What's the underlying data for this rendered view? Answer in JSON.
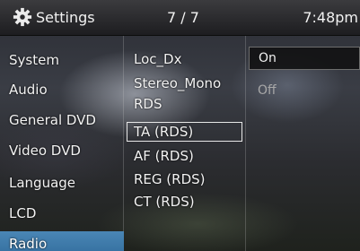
{
  "header": {
    "icon": "gear-icon",
    "title": "Settings",
    "page": "7 / 7",
    "clock": "7:48pm"
  },
  "categories": [
    {
      "label": "System"
    },
    {
      "label": "Audio"
    },
    {
      "label": "General DVD"
    },
    {
      "label": "Video DVD"
    },
    {
      "label": "Language"
    },
    {
      "label": "LCD"
    },
    {
      "label": "Radio",
      "selected": true
    }
  ],
  "options": [
    {
      "label": "Loc_Dx"
    },
    {
      "label": "Stereo_Mono"
    },
    {
      "label": "RDS"
    },
    {
      "label": "TA (RDS)",
      "focused": true
    },
    {
      "label": "AF (RDS)"
    },
    {
      "label": "REG (RDS)"
    },
    {
      "label": "CT (RDS)"
    }
  ],
  "values": {
    "current": "On",
    "other": "Off"
  },
  "colors": {
    "selected_highlight": "#3f7aab",
    "header_top": "#3b3b3e",
    "text": "#f3f3f3"
  }
}
